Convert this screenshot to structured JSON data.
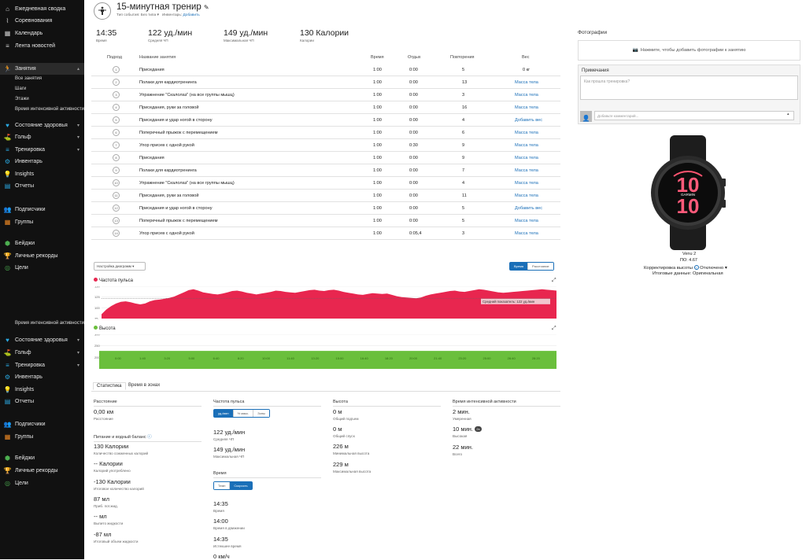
{
  "sidebar": {
    "top": [
      {
        "label": "Ежедневная сводка",
        "icon": "home-icon"
      },
      {
        "label": "Соревнования",
        "icon": "trend-icon"
      },
      {
        "label": "Календарь",
        "icon": "calendar-icon"
      },
      {
        "label": "Лента новостей",
        "icon": "feed-icon"
      }
    ],
    "activities": {
      "label": "Занятия",
      "icon": "running-icon",
      "sub": [
        "Все занятия",
        "Шаги",
        "Этажи",
        "Время интенсивной активности"
      ]
    },
    "group1": [
      {
        "label": "Состояние здоровья",
        "icon": "heart-icon",
        "chev": true
      },
      {
        "label": "Гольф",
        "icon": "golf-icon",
        "chev": true
      },
      {
        "label": "Тренировка",
        "icon": "dumbbell-icon",
        "chev": true
      },
      {
        "label": "Инвентарь",
        "icon": "gear-icon",
        "chev": false
      },
      {
        "label": "Insights",
        "icon": "bulb-icon",
        "chev": false
      },
      {
        "label": "Отчеты",
        "icon": "report-icon",
        "chev": false
      }
    ],
    "group2": [
      {
        "label": "Подписчики",
        "icon": "people-icon"
      },
      {
        "label": "Группы",
        "icon": "group-icon"
      }
    ],
    "group3": [
      {
        "label": "Бейджи",
        "icon": "badge-icon"
      },
      {
        "label": "Личные рекорды",
        "icon": "trophy-icon"
      },
      {
        "label": "Цели",
        "icon": "target-icon"
      }
    ],
    "section2_title": "Время интенсивной активности",
    "accent_color": "#2aa8e0"
  },
  "header": {
    "title": "15-минутная тренир",
    "event_type_label": "Тип события:",
    "event_type_value": "Без типа",
    "gear_label": "Инвентарь:",
    "gear_link": "Добавить"
  },
  "summary": [
    {
      "value": "14:35",
      "label": "Время"
    },
    {
      "value": "122 уд./мин",
      "label": "Средняя ЧП"
    },
    {
      "value": "149 уд./мин",
      "label": "Максимальная ЧП"
    },
    {
      "value": "130 Калории",
      "label": "Калории"
    }
  ],
  "table": {
    "headers": {
      "set": "Подход",
      "name": "Название занятия",
      "time": "Время",
      "rest": "Отдых",
      "reps": "Повторения",
      "weight": "Вес"
    },
    "rows": [
      {
        "n": "1",
        "name": "Приседания",
        "time": "1:00",
        "rest": "0:00",
        "reps": "5",
        "weight": "0 кг",
        "link": false
      },
      {
        "n": "2",
        "name": "Полаки для кардиотренинга",
        "time": "1:00",
        "rest": "0:00",
        "reps": "13",
        "weight": "Масса тела",
        "link": true
      },
      {
        "n": "3",
        "name": "Упражнение \"Скалолаз\" (на все группы мышц)",
        "time": "1:00",
        "rest": "0:00",
        "reps": "3",
        "weight": "Масса тела",
        "link": true
      },
      {
        "n": "4",
        "name": "Приседания, руки за головой",
        "time": "1:00",
        "rest": "0:00",
        "reps": "16",
        "weight": "Масса тела",
        "link": true
      },
      {
        "n": "5",
        "name": "Приседания и удар ногой в сторону",
        "time": "1:00",
        "rest": "0:00",
        "reps": "4",
        "weight": "Добавить вес",
        "link": true
      },
      {
        "n": "6",
        "name": "Поперечный прыжок с перемещением",
        "time": "1:00",
        "rest": "0:00",
        "reps": "6",
        "weight": "Масса тела",
        "link": true
      },
      {
        "n": "7",
        "name": "Упор присев с одной рукой",
        "time": "1:00",
        "rest": "0:30",
        "reps": "9",
        "weight": "Масса тела",
        "link": true
      },
      {
        "n": "8",
        "name": "Приседания",
        "time": "1:00",
        "rest": "0:00",
        "reps": "9",
        "weight": "Масса тела",
        "link": true
      },
      {
        "n": "9",
        "name": "Полаки для кардиотренинга",
        "time": "1:00",
        "rest": "0:00",
        "reps": "7",
        "weight": "Масса тела",
        "link": true
      },
      {
        "n": "10",
        "name": "Упражнение \"Скалолаз\" (на все группы мышц)",
        "time": "1:00",
        "rest": "0:00",
        "reps": "4",
        "weight": "Масса тела",
        "link": true
      },
      {
        "n": "11",
        "name": "Приседания, руки за головой",
        "time": "1:00",
        "rest": "0:00",
        "reps": "11",
        "weight": "Масса тела",
        "link": true
      },
      {
        "n": "12",
        "name": "Приседания и удар ногой в сторону",
        "time": "1:00",
        "rest": "0:00",
        "reps": "5",
        "weight": "Добавить вес",
        "link": true
      },
      {
        "n": "13",
        "name": "Поперечный прыжок с перемещением",
        "time": "1:00",
        "rest": "0:00",
        "reps": "5",
        "weight": "Масса тела",
        "link": true
      },
      {
        "n": "14",
        "name": "Упор присев с одной рукой",
        "time": "1:00",
        "rest": "0:05,4",
        "reps": "3",
        "weight": "Масса тела",
        "link": true
      }
    ]
  },
  "charts_controls": {
    "settings": "Настройка диаграмм",
    "toggle": [
      "Время",
      "Расстояние"
    ],
    "active": 0
  },
  "hr_chart": {
    "title": "Частота пульса",
    "color": "#e8264f",
    "avg_label": "Средний показатель: 122 уд./мин",
    "chart_data": {
      "type": "area",
      "ylim": [
        75,
        150
      ],
      "y_ticks": [
        "150",
        "125",
        "100",
        "75"
      ],
      "values": [
        85,
        96,
        104,
        110,
        114,
        115,
        113,
        110,
        108,
        110,
        115,
        118,
        119,
        121,
        123,
        126,
        131,
        136,
        141,
        143,
        140,
        136,
        134,
        132,
        131,
        133,
        136,
        139,
        140,
        138,
        135,
        133,
        131,
        133,
        135,
        137,
        140,
        139,
        137,
        136,
        135,
        137,
        139,
        141,
        142,
        140,
        139,
        141,
        142,
        140,
        137,
        135,
        133,
        131,
        130,
        132,
        134,
        133,
        132,
        133,
        130,
        127,
        125,
        124,
        123,
        122,
        124,
        128,
        131,
        133,
        135,
        137,
        139,
        140,
        138,
        137,
        139,
        141,
        143,
        142,
        140,
        138,
        136,
        135,
        136,
        137,
        138,
        139,
        140,
        141,
        142,
        143,
        142,
        141,
        140
      ]
    }
  },
  "alt_chart": {
    "title": "Высота",
    "color": "#6abf3c",
    "chart_data": {
      "type": "area",
      "ylim": [
        150,
        300
      ],
      "y_ticks": [
        "300",
        "250",
        "200"
      ],
      "x_ticks": [
        "0:00",
        "1:40",
        "3:20",
        "5:00",
        "6:40",
        "8:20",
        "10:00",
        "11:40",
        "13:20",
        "15:00",
        "16:40",
        "18:20",
        "20:00",
        "21:40",
        "23:20",
        "25:00",
        "26:40",
        "28:20"
      ],
      "values": [
        228,
        228,
        228,
        228,
        228,
        228,
        228,
        228,
        228,
        228,
        228,
        228,
        228,
        228,
        228,
        228,
        228,
        228,
        228,
        228,
        228,
        228,
        228,
        228,
        228,
        228,
        228,
        228,
        228,
        228,
        228,
        228,
        228,
        228,
        228,
        228,
        228,
        228,
        228,
        228,
        228,
        228,
        228,
        228,
        228,
        228,
        228,
        228,
        228,
        228
      ]
    }
  },
  "tabs": [
    "Статистика",
    "Время в зонах"
  ],
  "stats": {
    "distance": {
      "head": "Расстояние",
      "value": "0,00 км",
      "label": "Расстояние"
    },
    "nutrition": {
      "head": "Питание и водный баланс",
      "items": [
        {
          "value": "130 Калории",
          "label": "Количество сожженных калорий"
        },
        {
          "value": "-- Калории",
          "label": "Калорий употреблено"
        },
        {
          "value": "-130 Калории",
          "label": "Итоговое количество калорий"
        },
        {
          "value": "87 мл",
          "label": "Приб. пот.жид."
        },
        {
          "value": "-- мл",
          "label": "Выпито жидкости"
        },
        {
          "value": "-87 мл",
          "label": "Итоговый объем жидкости"
        }
      ]
    },
    "hr": {
      "head": "Частота пульса",
      "toggle": [
        "уд./мин",
        "% макс.",
        "Зоны"
      ],
      "items": [
        {
          "value": "122 уд./мин",
          "label": "Средняя ЧП"
        },
        {
          "value": "149 уд./мин",
          "label": "Максимальная ЧП"
        }
      ]
    },
    "time": {
      "head": "Время",
      "toggle": [
        "Темп",
        "Скорость"
      ],
      "items": [
        {
          "value": "14:35",
          "label": "Время"
        },
        {
          "value": "14:00",
          "label": "Время в движении"
        },
        {
          "value": "14:35",
          "label": "Истекшее время"
        },
        {
          "value": "0 км/ч",
          "label": ""
        }
      ]
    },
    "altitude": {
      "head": "Высота",
      "items": [
        {
          "value": "0 м",
          "label": "Общий подъем"
        },
        {
          "value": "0 м",
          "label": "Общий спуск"
        },
        {
          "value": "226 м",
          "label": "Минимальная высота"
        },
        {
          "value": "229 м",
          "label": "Максимальная высота"
        }
      ]
    },
    "intensity": {
      "head": "Время интенсивной активности",
      "items": [
        {
          "value": "2 мин.",
          "label": "Умеренная"
        },
        {
          "value": "10 мин.",
          "label": "Высокая",
          "badge": "2x"
        },
        {
          "value": "22 мин.",
          "label": "Всего"
        }
      ]
    }
  },
  "right": {
    "photos_title": "Фотографии",
    "photos_add": "Нажмите, чтобы добавить фотографии к занятию",
    "notes_title": "Примечания",
    "notes_placeholder": "Как прошла тренировка?",
    "comment_placeholder": "Добавьте комментарий...",
    "watch_brand": "GARMIN",
    "watch_time_top": "10",
    "watch_time_bottom": "10",
    "device_name": "Venu 2",
    "device_sw": "ПО: 4.67",
    "altitude_corr_label": "Корректировка высоты",
    "altitude_corr_value": "Отключено",
    "final_data": "Итоговые данные: Оригинальная"
  }
}
